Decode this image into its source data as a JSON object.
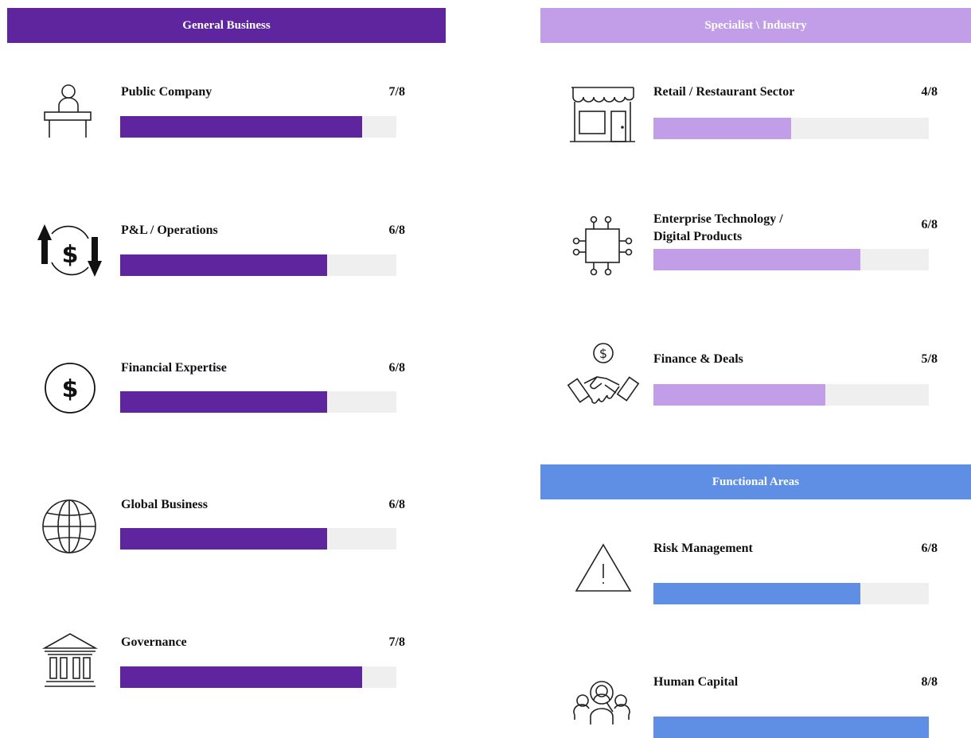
{
  "chart_data": {
    "type": "bar",
    "max_score": 8,
    "colors": {
      "general_business": "#5F259F",
      "specialist_industry": "#C39EE8",
      "functional_areas": "#5F8FE5",
      "track": "#EFEFEF"
    },
    "sections": {
      "general_business": {
        "title": "General Business",
        "items": [
          {
            "label": "Public Company",
            "score_text": "7/8",
            "value": 7,
            "icon": "reception-desk-icon"
          },
          {
            "label": "P&L / Operations",
            "score_text": "6/8",
            "value": 6,
            "icon": "dollar-updown-arrows-icon"
          },
          {
            "label": "Financial Expertise",
            "score_text": "6/8",
            "value": 6,
            "icon": "dollar-circle-icon"
          },
          {
            "label": "Global Business",
            "score_text": "6/8",
            "value": 6,
            "icon": "globe-icon"
          },
          {
            "label": "Governance",
            "score_text": "7/8",
            "value": 7,
            "icon": "institution-building-icon"
          }
        ]
      },
      "specialist_industry": {
        "title": "Specialist \\ Industry",
        "items": [
          {
            "label": "Retail / Restaurant Sector",
            "score_text": "4/8",
            "value": 4,
            "icon": "storefront-icon"
          },
          {
            "label_line1": "Enterprise Technology /",
            "label_line2": "Digital Products",
            "score_text": "6/8",
            "value": 6,
            "icon": "microchip-icon"
          },
          {
            "label": "Finance & Deals",
            "score_text": "5/8",
            "value": 5,
            "icon": "handshake-dollar-icon"
          }
        ]
      },
      "functional_areas": {
        "title": "Functional Areas",
        "items": [
          {
            "label": "Risk Management",
            "score_text": "6/8",
            "value": 6,
            "icon": "warning-triangle-icon"
          },
          {
            "label": "Human Capital",
            "score_text": "8/8",
            "value": 8,
            "icon": "people-search-icon"
          }
        ]
      }
    }
  }
}
